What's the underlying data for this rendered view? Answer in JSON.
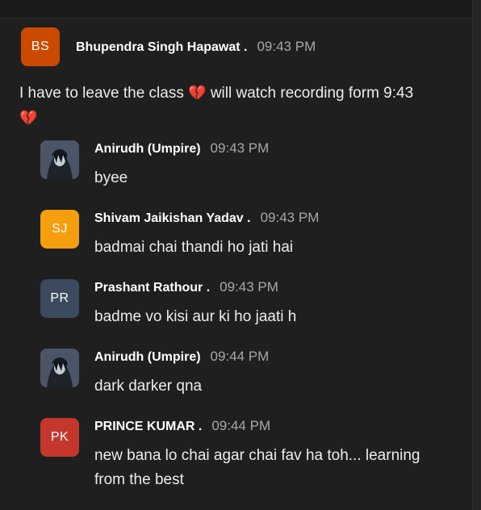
{
  "messages": [
    {
      "avatar_initials": "BS",
      "avatar_color": "#cc4a00",
      "sender": "Bhupendra Singh Hapawat .",
      "time": "09:43 PM",
      "text_part1": "I have to leave the class",
      "text_part2": "will watch recording form 9:43",
      "emoji": "💔",
      "emoji_name": "broken-heart"
    },
    {
      "avatar_image": "anime-character-avatar",
      "sender": "Anirudh (Umpire)",
      "time": "09:43 PM",
      "text": "byee"
    },
    {
      "avatar_initials": "SJ",
      "avatar_color": "#f59f0e",
      "sender": "Shivam Jaikishan Yadav .",
      "time": "09:43 PM",
      "text": "badmai chai thandi ho jati hai"
    },
    {
      "avatar_initials": "PR",
      "avatar_color": "#3b4a5e",
      "sender": "Prashant Rathour .",
      "time": "09:43 PM",
      "text": "badme vo kisi aur ki ho jaati h"
    },
    {
      "avatar_image": "anime-character-avatar",
      "sender": "Anirudh (Umpire)",
      "time": "09:44 PM",
      "text": "dark darker qna"
    },
    {
      "avatar_initials": "PK",
      "avatar_color": "#c4372d",
      "sender": "PRINCE KUMAR .",
      "time": "09:44 PM",
      "text_line1": "new bana lo chai agar chai fav ha toh... learning",
      "text_line2": "from the best"
    }
  ]
}
